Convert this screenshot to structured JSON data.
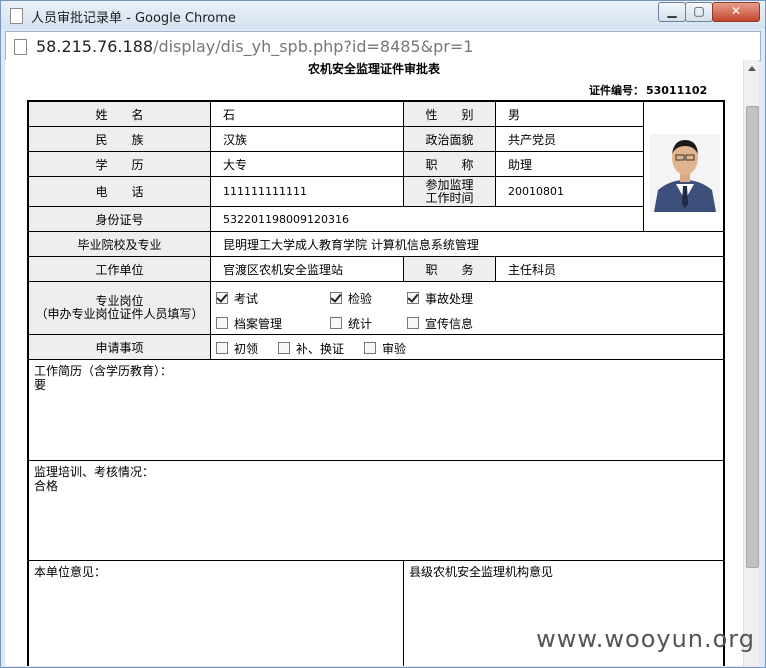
{
  "window": {
    "title": "人员审批记录单 - Google Chrome",
    "min_label": "▁",
    "max_label": "▢",
    "close_label": "✕"
  },
  "address": {
    "host": "58.215.76.188",
    "path": "/display/dis_yh_spb.php?id=8485&pr=1"
  },
  "doc": {
    "title": "农机安全监理证件审批表",
    "cert_label": "证件编号：",
    "cert_no": "53011102"
  },
  "form": {
    "name_label": "姓　　名",
    "name": "石",
    "gender_label": "性　　别",
    "gender": "男",
    "ethnicity_label": "民　　族",
    "ethnicity": "汉族",
    "politics_label": "政治面貌",
    "politics": "共产党员",
    "education_label": "学　　历",
    "education": "大专",
    "title_label": "职　　称",
    "title": "助理",
    "phone_label": "电　　话",
    "phone": "111111111111",
    "join_label_1": "参加监理",
    "join_label_2": "工作时间",
    "join_date": "20010801",
    "id_label": "身份证号",
    "id_number": "532201198009120316",
    "school_label": "毕业院校及专业",
    "school": "昆明理工大学成人教育学院 计算机信息系统管理",
    "unit_label": "工作单位",
    "unit": "官渡区农机安全监理站",
    "position_label": "职　　务",
    "position": "主任科员",
    "post_label_1": "专业岗位",
    "post_label_2": "（申办专业岗位证件人员填写）",
    "posts": [
      {
        "label": "考试",
        "checked": true
      },
      {
        "label": "检验",
        "checked": true
      },
      {
        "label": "事故处理",
        "checked": true
      },
      {
        "label": "档案管理",
        "checked": false
      },
      {
        "label": "统计",
        "checked": false
      },
      {
        "label": "宣传信息",
        "checked": false
      }
    ],
    "apply_label": "申请事项",
    "apply": [
      {
        "label": "初领",
        "checked": false
      },
      {
        "label": "补、换证",
        "checked": false
      },
      {
        "label": "审验",
        "checked": false
      }
    ],
    "resume_label": "工作简历（含学历教育）：",
    "resume": "要",
    "training_label": "监理培训、考核情况：",
    "training": "合格",
    "unit_opinion_label": "本单位意见：",
    "county_opinion_label": "县级农机安全监理机构意见"
  },
  "watermark": "www.wooyun.org"
}
